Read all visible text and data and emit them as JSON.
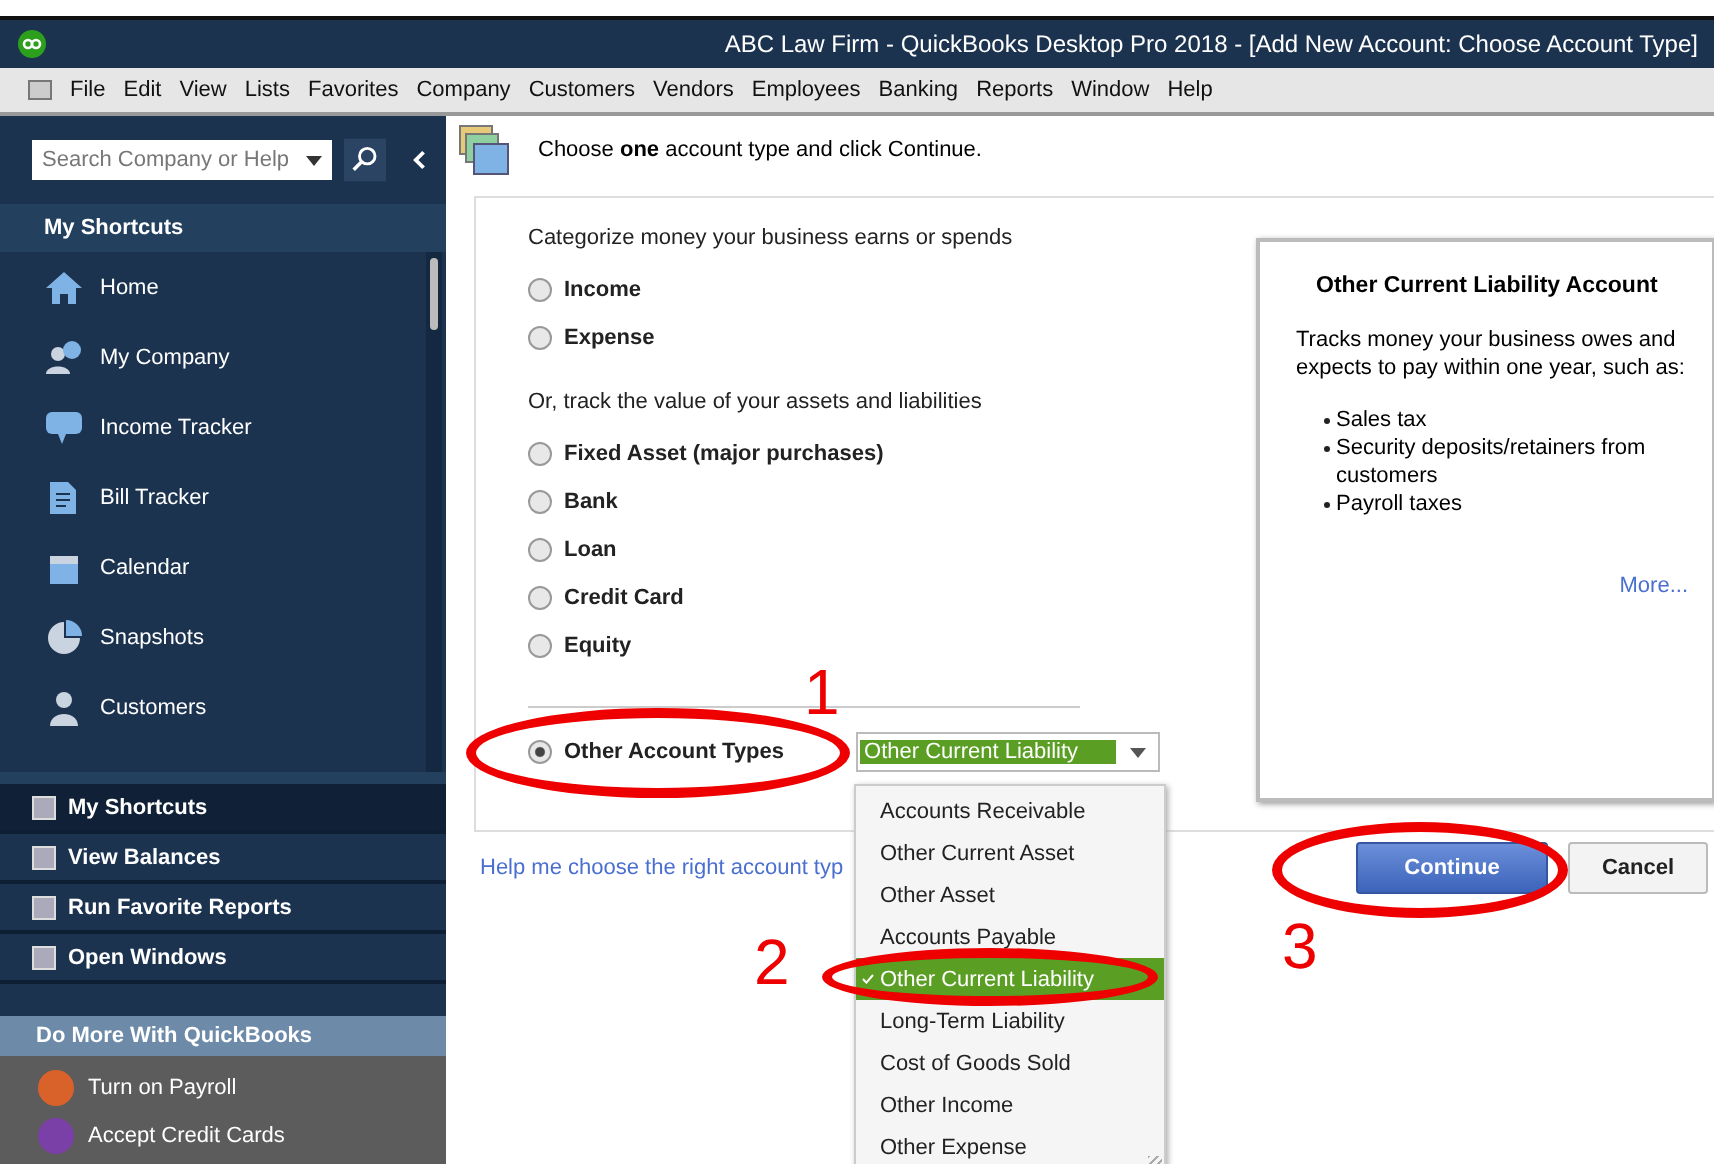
{
  "window": {
    "title": "ABC Law Firm  - QuickBooks Desktop Pro 2018 - [Add New Account: Choose Account Type]"
  },
  "menu": [
    "File",
    "Edit",
    "View",
    "Lists",
    "Favorites",
    "Company",
    "Customers",
    "Vendors",
    "Employees",
    "Banking",
    "Reports",
    "Window",
    "Help"
  ],
  "sidebar": {
    "search": {
      "placeholder": "Search Company or Help"
    },
    "header": "My Shortcuts",
    "items": [
      "Home",
      "My Company",
      "Income Tracker",
      "Bill Tracker",
      "Calendar",
      "Snapshots",
      "Customers"
    ],
    "sections": [
      {
        "label": "My Shortcuts",
        "selected": true
      },
      {
        "label": "View Balances",
        "selected": false
      },
      {
        "label": "Run Favorite Reports",
        "selected": false
      },
      {
        "label": "Open Windows",
        "selected": false
      }
    ],
    "promo_header": "Do More With QuickBooks",
    "promos": [
      {
        "label": "Turn on Payroll",
        "color": "#d9622b"
      },
      {
        "label": "Accept Credit Cards",
        "color": "#7b3fa8"
      }
    ]
  },
  "instruction": "Choose **one** account type and click Continue.",
  "group_1": {
    "heading": "Categorize money your business earns or spends",
    "options": [
      {
        "label": "Income",
        "selected": false
      },
      {
        "label": "Expense",
        "selected": false
      }
    ]
  },
  "group_2": {
    "heading": "Or, track the value of your assets and liabilities",
    "options": [
      {
        "label": "Fixed Asset (major purchases)",
        "selected": false
      },
      {
        "label": "Bank",
        "selected": false
      },
      {
        "label": "Loan",
        "selected": false
      },
      {
        "label": "Credit Card",
        "selected": false
      },
      {
        "label": "Equity",
        "selected": false
      }
    ]
  },
  "other": {
    "label": "Other Account Types",
    "selected": true,
    "value": "Other Current Liability",
    "options": [
      {
        "label": "Accounts Receivable",
        "selected": false
      },
      {
        "label": "Other Current Asset",
        "selected": false
      },
      {
        "label": "Other Asset",
        "selected": false
      },
      {
        "label": "Accounts Payable",
        "selected": false
      },
      {
        "label": "Other Current Liability",
        "selected": true
      },
      {
        "label": "Long-Term Liability",
        "selected": false
      },
      {
        "label": "Cost of Goods Sold",
        "selected": false
      },
      {
        "label": "Other Income",
        "selected": false
      },
      {
        "label": "Other Expense",
        "selected": false
      }
    ]
  },
  "help_link": "Help me choose the right account typ",
  "info": {
    "title": "Other Current Liability Account",
    "text": "Tracks money your business owes and expects to pay within one year, such as:",
    "bullets": [
      "Sales tax",
      "Security deposits/retainers from customers",
      "Payroll taxes"
    ],
    "more": "More..."
  },
  "buttons": [
    "Continue",
    "Cancel"
  ],
  "annotations": [
    "1",
    "2",
    "3"
  ]
}
